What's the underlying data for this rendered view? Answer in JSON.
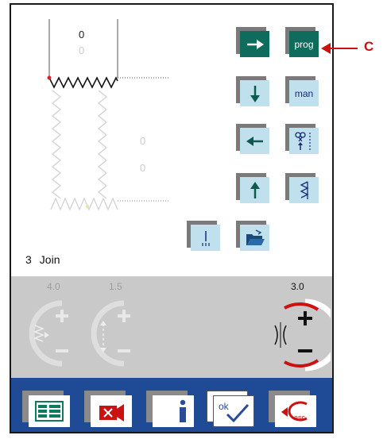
{
  "canvas": {
    "top_value": "0",
    "top_ghost_value": "0",
    "right_ghost_value_1": "0",
    "right_ghost_value_2": "0"
  },
  "status": {
    "number": "3",
    "name": "Join"
  },
  "buttons": {
    "prog_label": "prog",
    "man_label": "man"
  },
  "panel": {
    "width_value": "4.0",
    "length_value": "1.5",
    "tension_value": "3.0"
  },
  "callout": {
    "label": "C"
  },
  "colors": {
    "accent_dark": "#0f6b5c",
    "button_light": "#bfe0ec",
    "dock_blue": "#1f4a96",
    "tension_red": "#cc1111"
  }
}
